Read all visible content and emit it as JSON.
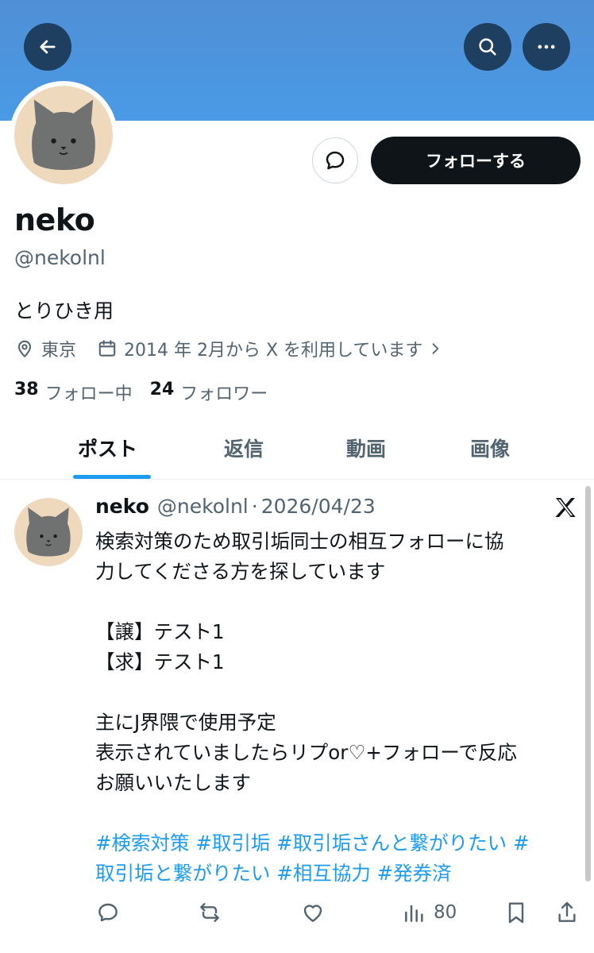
{
  "header": {
    "back_icon": "arrow-left-icon",
    "search_icon": "search-icon",
    "more_icon": "more-horizontal-icon",
    "banner_color": "#4a9ae6"
  },
  "profile": {
    "display_name": "neko",
    "handle": "@nekolnl",
    "bio": "とりひき用",
    "location": "東京",
    "joined": "2014 年 2月から X を利用しています",
    "following_count": "38",
    "following_label": "フォロー中",
    "followers_count": "24",
    "followers_label": "フォロワー",
    "follow_button": "フォローする"
  },
  "tabs": [
    {
      "label": "ポスト",
      "active": true
    },
    {
      "label": "返信",
      "active": false
    },
    {
      "label": "動画",
      "active": false
    },
    {
      "label": "画像",
      "active": false
    }
  ],
  "post": {
    "name": "neko",
    "handle": "@nekolnl",
    "separator": "·",
    "date": "2026/04/23",
    "lines": [
      "検索対策のため取引垢同士の相互フォローに協",
      "力してくださる方を探しています",
      "",
      "【譲】テスト1",
      "【求】テスト1",
      "",
      "主にJ界隈で使用予定",
      "表示されていましたらリプor♡+フォローで反応",
      "お願いいたします",
      ""
    ],
    "hashtag_line_1": "#検索対策  #取引垢 #取引垢さんと繋がりたい #",
    "hashtag_line_2": "取引垢と繋がりたい #相互協力 #発券済",
    "views": "80"
  },
  "colors": {
    "accent": "#1d9bf0",
    "text": "#0f1419",
    "muted": "#536471",
    "avatar_bg": "#efd9bd"
  }
}
